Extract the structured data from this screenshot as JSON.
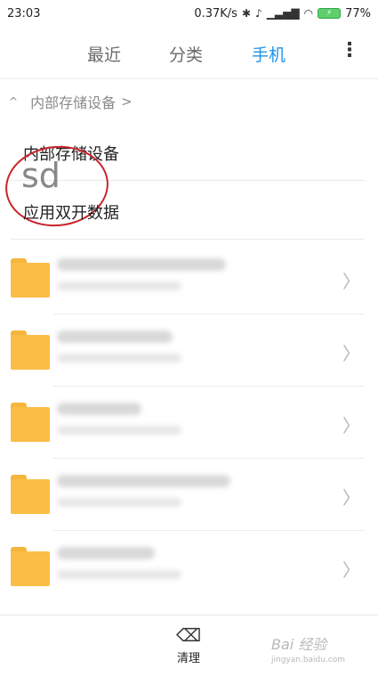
{
  "status": {
    "time": "23:03",
    "network_speed": "0.37K/s",
    "battery": "77%"
  },
  "tabs": {
    "recent": "最近",
    "category": "分类",
    "phone": "手机",
    "active": "手机",
    "active_color": "#1e95ea"
  },
  "breadcrumb": {
    "label": "内部存储设备",
    "chevron": ">"
  },
  "storage": {
    "internal": "内部存储设备",
    "dual_app": "应用双开数据",
    "annotation": "sd",
    "annotation_color": "#c8242c"
  },
  "folders": [
    {
      "icon": "folder-icon",
      "color": "#fbbd45"
    },
    {
      "icon": "folder-icon",
      "color": "#fbbd45"
    },
    {
      "icon": "folder-icon",
      "color": "#fbbd45"
    },
    {
      "icon": "folder-icon",
      "color": "#fbbd45"
    },
    {
      "icon": "folder-icon",
      "color": "#fbbd45"
    }
  ],
  "bottom": {
    "clean_label": "清理",
    "watermark": "Bai 经验",
    "watermark_url": "jingyan.baidu.com"
  }
}
